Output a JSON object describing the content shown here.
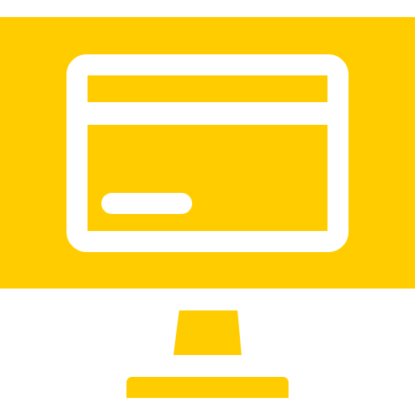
{
  "icon": {
    "name": "computer-monitor-icon",
    "inner": "credit-card-icon"
  },
  "colors": {
    "accent": "#FFCC00",
    "background": "#FFFFFF"
  }
}
